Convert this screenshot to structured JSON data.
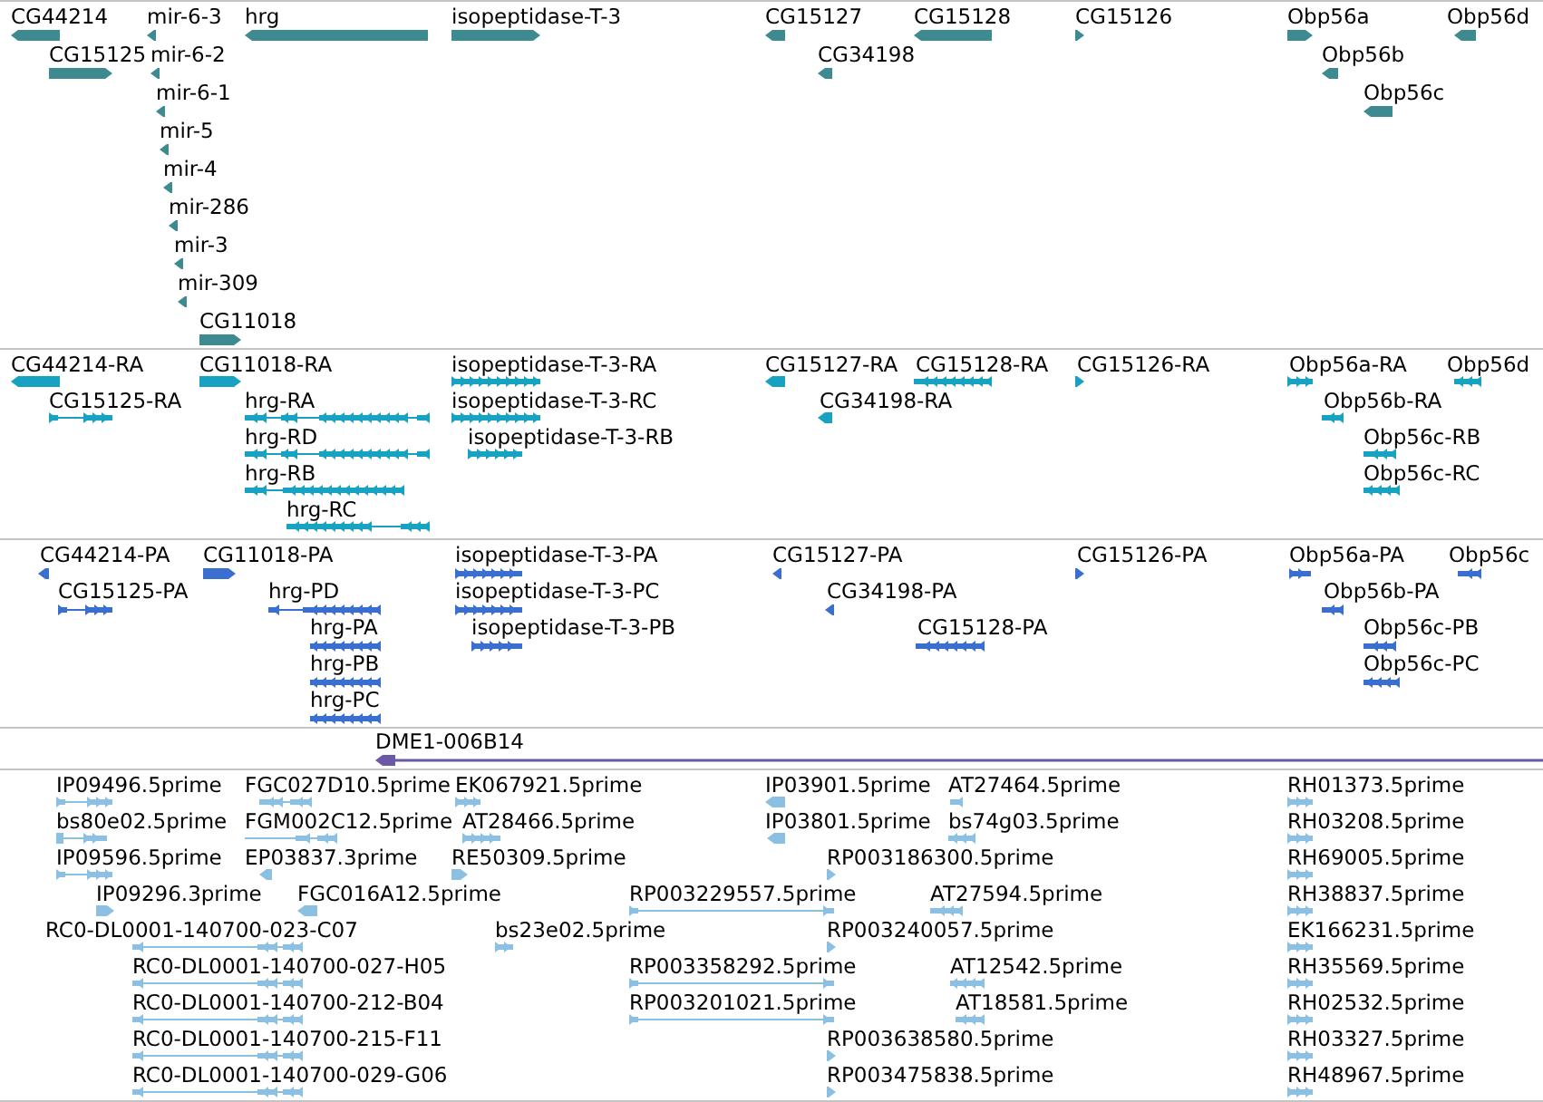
{
  "tracks": [
    {
      "color": "#3d8b91",
      "rows": [
        {
          "features": [
            {
              "label": "CG44214",
              "reverse_strand": true
            },
            {
              "label": "mir-6-3",
              "reverse_strand": true
            },
            {
              "label": "hrg",
              "reverse_strand": true
            },
            {
              "label": "isopeptidase-T-3",
              "reverse_strand": false
            },
            {
              "label": "CG15127",
              "reverse_strand": true
            },
            {
              "label": "CG15128",
              "reverse_strand": true
            },
            {
              "label": "CG15126",
              "reverse_strand": false
            },
            {
              "label": "Obp56a",
              "reverse_strand": false
            },
            {
              "label": "Obp56d",
              "reverse_strand": true
            }
          ]
        },
        {
          "features": [
            {
              "label": "CG15125",
              "reverse_strand": false
            },
            {
              "label": "mir-6-2",
              "reverse_strand": true
            },
            {
              "label": "CG34198",
              "reverse_strand": true
            },
            {
              "label": "Obp56b",
              "reverse_strand": true
            }
          ]
        },
        {
          "features": [
            {
              "label": "mir-6-1",
              "reverse_strand": true
            },
            {
              "label": "Obp56c",
              "reverse_strand": true
            }
          ]
        },
        {
          "features": [
            {
              "label": "mir-5",
              "reverse_strand": true
            }
          ]
        },
        {
          "features": [
            {
              "label": "mir-4",
              "reverse_strand": true
            }
          ]
        },
        {
          "features": [
            {
              "label": "mir-286",
              "reverse_strand": true
            }
          ]
        },
        {
          "features": [
            {
              "label": "mir-3",
              "reverse_strand": true
            }
          ]
        },
        {
          "features": [
            {
              "label": "mir-309",
              "reverse_strand": true
            }
          ]
        },
        {
          "features": [
            {
              "label": "CG11018",
              "reverse_strand": false
            }
          ]
        }
      ]
    },
    {
      "color": "#17a2c2",
      "rows": [
        {
          "features": [
            {
              "label": "CG44214-RA",
              "reverse_strand": true
            },
            {
              "label": "CG11018-RA",
              "reverse_strand": false
            },
            {
              "label": "isopeptidase-T-3-RA",
              "reverse_strand": false
            },
            {
              "label": "CG15127-RA",
              "reverse_strand": true
            },
            {
              "label": "CG15128-RA",
              "reverse_strand": true
            },
            {
              "label": "CG15126-RA",
              "reverse_strand": false
            },
            {
              "label": "Obp56a-RA",
              "reverse_strand": false
            },
            {
              "label": "Obp56d",
              "reverse_strand": true
            }
          ]
        },
        {
          "features": [
            {
              "label": "CG15125-RA",
              "reverse_strand": false
            },
            {
              "label": "hrg-RA",
              "reverse_strand": true
            },
            {
              "label": "isopeptidase-T-3-RC",
              "reverse_strand": false
            },
            {
              "label": "CG34198-RA",
              "reverse_strand": true
            },
            {
              "label": "Obp56b-RA",
              "reverse_strand": true
            }
          ]
        },
        {
          "features": [
            {
              "label": "hrg-RD",
              "reverse_strand": true
            },
            {
              "label": "isopeptidase-T-3-RB",
              "reverse_strand": false
            },
            {
              "label": "Obp56c-RB",
              "reverse_strand": true
            }
          ]
        },
        {
          "features": [
            {
              "label": "hrg-RB",
              "reverse_strand": true
            },
            {
              "label": "Obp56c-RC",
              "reverse_strand": true
            }
          ]
        },
        {
          "features": [
            {
              "label": "hrg-RC",
              "reverse_strand": true
            }
          ]
        }
      ]
    },
    {
      "color": "#3a6fcf",
      "rows": [
        {
          "features": [
            {
              "label": "CG44214-PA",
              "reverse_strand": true
            },
            {
              "label": "CG11018-PA",
              "reverse_strand": false
            },
            {
              "label": "isopeptidase-T-3-PA",
              "reverse_strand": false
            },
            {
              "label": "CG15127-PA",
              "reverse_strand": true
            },
            {
              "label": "CG15126-PA",
              "reverse_strand": false
            },
            {
              "label": "Obp56a-PA",
              "reverse_strand": false
            },
            {
              "label": "Obp56c",
              "reverse_strand": true
            }
          ]
        },
        {
          "features": [
            {
              "label": "CG15125-PA",
              "reverse_strand": false
            },
            {
              "label": "hrg-PD",
              "reverse_strand": true
            },
            {
              "label": "isopeptidase-T-3-PC",
              "reverse_strand": false
            },
            {
              "label": "CG34198-PA",
              "reverse_strand": true
            },
            {
              "label": "Obp56b-PA",
              "reverse_strand": true
            }
          ]
        },
        {
          "features": [
            {
              "label": "hrg-PA",
              "reverse_strand": true
            },
            {
              "label": "isopeptidase-T-3-PB",
              "reverse_strand": false
            },
            {
              "label": "CG15128-PA",
              "reverse_strand": true
            },
            {
              "label": "Obp56c-PB",
              "reverse_strand": true
            }
          ]
        },
        {
          "features": [
            {
              "label": "hrg-PB",
              "reverse_strand": true
            },
            {
              "label": "Obp56c-PC",
              "reverse_strand": true
            }
          ]
        },
        {
          "features": [
            {
              "label": "hrg-PC",
              "reverse_strand": true
            }
          ]
        }
      ]
    },
    {
      "color": "#6b58a6",
      "rows": [
        {
          "features": [
            {
              "label": "DME1-006B14",
              "reverse_strand": true
            }
          ]
        }
      ]
    },
    {
      "color": "#8cc0e2",
      "rows": [
        {
          "features": [
            {
              "label": "IP09496.5prime",
              "reverse_strand": false
            },
            {
              "label": "FGC027D10.5prime",
              "reverse_strand": true
            },
            {
              "label": "EK067921.5prime",
              "reverse_strand": false
            },
            {
              "label": "IP03901.5prime",
              "reverse_strand": true
            },
            {
              "label": "AT27464.5prime",
              "reverse_strand": true
            },
            {
              "label": "RH01373.5prime",
              "reverse_strand": false
            }
          ]
        },
        {
          "features": [
            {
              "label": "bs80e02.5prime",
              "reverse_strand": false
            },
            {
              "label": "FGM002C12.5prime",
              "reverse_strand": true
            },
            {
              "label": "AT28466.5prime",
              "reverse_strand": false
            },
            {
              "label": "IP03801.5prime",
              "reverse_strand": true
            },
            {
              "label": "bs74g03.5prime",
              "reverse_strand": true
            },
            {
              "label": "RH03208.5prime",
              "reverse_strand": false
            }
          ]
        },
        {
          "features": [
            {
              "label": "IP09596.5prime",
              "reverse_strand": false
            },
            {
              "label": "EP03837.3prime",
              "reverse_strand": true
            },
            {
              "label": "RE50309.5prime",
              "reverse_strand": false
            },
            {
              "label": "RP003186300.5prime",
              "reverse_strand": false
            },
            {
              "label": "RH69005.5prime",
              "reverse_strand": false
            }
          ]
        },
        {
          "features": [
            {
              "label": "IP09296.3prime",
              "reverse_strand": false
            },
            {
              "label": "FGC016A12.5prime",
              "reverse_strand": true
            },
            {
              "label": "RP003229557.5prime",
              "reverse_strand": false
            },
            {
              "label": "AT27594.5prime",
              "reverse_strand": true
            },
            {
              "label": "RH38837.5prime",
              "reverse_strand": false
            }
          ]
        },
        {
          "features": [
            {
              "label": "RC0-DL0001-140700-023-C07",
              "reverse_strand": true
            },
            {
              "label": "bs23e02.5prime",
              "reverse_strand": false
            },
            {
              "label": "RP003240057.5prime",
              "reverse_strand": false
            },
            {
              "label": "EK166231.5prime",
              "reverse_strand": false
            }
          ]
        },
        {
          "features": [
            {
              "label": "RC0-DL0001-140700-027-H05",
              "reverse_strand": true
            },
            {
              "label": "RP003358292.5prime",
              "reverse_strand": false
            },
            {
              "label": "AT12542.5prime",
              "reverse_strand": true
            },
            {
              "label": "RH35569.5prime",
              "reverse_strand": false
            }
          ]
        },
        {
          "features": [
            {
              "label": "RC0-DL0001-140700-212-B04",
              "reverse_strand": true
            },
            {
              "label": "RP003201021.5prime",
              "reverse_strand": false
            },
            {
              "label": "AT18581.5prime",
              "reverse_strand": true
            },
            {
              "label": "RH02532.5prime",
              "reverse_strand": false
            }
          ]
        },
        {
          "features": [
            {
              "label": "RC0-DL0001-140700-215-F11",
              "reverse_strand": true
            },
            {
              "label": "RP003638580.5prime",
              "reverse_strand": false
            },
            {
              "label": "RH03327.5prime",
              "reverse_strand": false
            }
          ]
        },
        {
          "features": [
            {
              "label": "RC0-DL0001-140700-029-G06",
              "reverse_strand": true
            },
            {
              "label": "RP003475838.5prime",
              "reverse_strand": false
            },
            {
              "label": "RH48967.5prime",
              "reverse_strand": false
            }
          ]
        }
      ]
    }
  ]
}
